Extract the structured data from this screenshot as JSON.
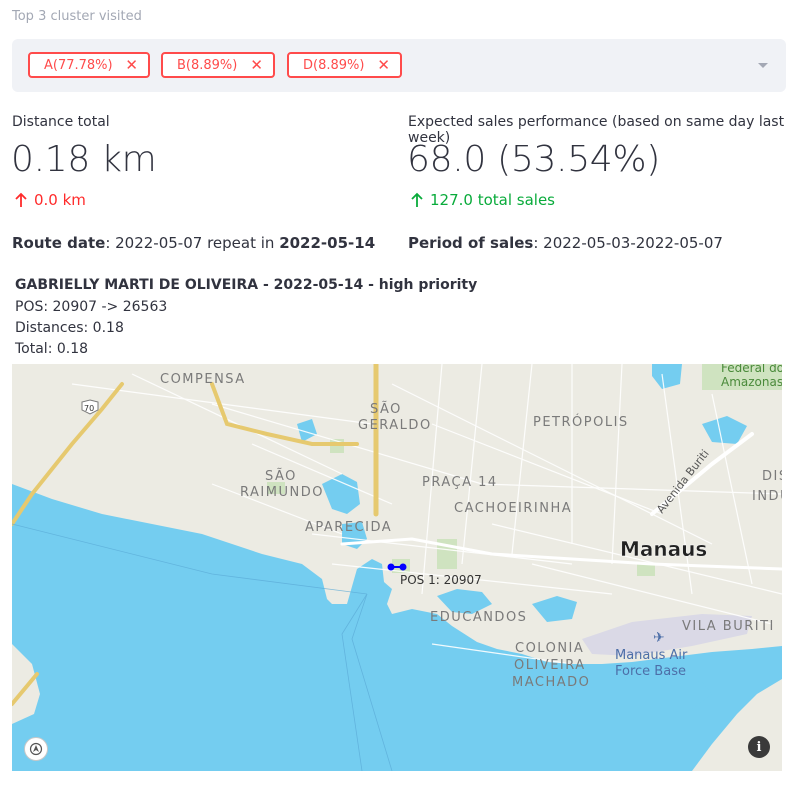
{
  "filter": {
    "label": "Top 3 cluster visited",
    "tags": [
      {
        "label": "A(77.78%)",
        "remove": "✕"
      },
      {
        "label": "B(8.89%)",
        "remove": "✕"
      },
      {
        "label": "D(8.89%)",
        "remove": "✕"
      }
    ]
  },
  "metrics": {
    "distance": {
      "label": "Distance total",
      "value": "0.18 km",
      "delta": "0.0 km"
    },
    "sales": {
      "label": "Expected sales performance (based on same day last week)",
      "value": "68.0 (53.54%)",
      "delta": "127.0 total sales"
    }
  },
  "info": {
    "route_label": "Route date",
    "route_value": ": 2022-05-07 repeat in ",
    "route_repeat": "2022-05-14",
    "period_label": "Period of sales",
    "period_value": ": 2022-05-03-2022-05-07"
  },
  "route": {
    "header": "GABRIELLY MARTI DE OLIVEIRA - 2022-05-14 - high priority",
    "pos": "POS: 20907 -> 26563",
    "distances": "Distances: 0.18",
    "total": "Total: 0.18"
  },
  "map": {
    "labels": {
      "compensa": "COMPENSA",
      "sao_geraldo_1": "SÃO",
      "sao_geraldo_2": "GERALDO",
      "petropolis": "PETRÓPOLIS",
      "sao_raimundo_1": "SÃO",
      "sao_raimundo_2": "RAIMUNDO",
      "praca14": "PRAÇA 14",
      "cachoeirinha": "CACHOEIRINHA",
      "aparecida": "APARECIDA",
      "manaus": "Manaus",
      "educandos": "EDUCANDOS",
      "colonia_1": "COLONIA",
      "colonia_2": "OLIVEIRA",
      "colonia_3": "MACHADO",
      "vila_buriti": "VILA BURITI",
      "air_base_1": "Manaus Air",
      "air_base_2": "Force Base",
      "avenida": "Avenida Buriti",
      "federal_1": "Federal do",
      "federal_2": "Amazonas",
      "dis": "DIS",
      "indu": "INDU",
      "road_70": "70",
      "pos_label": "POS 1: 20907"
    },
    "info_glyph": "i",
    "colors": {
      "water": "#74cdf0",
      "land": "#ecebe3",
      "park": "#cfe3c0",
      "marker": "#0000ff"
    }
  }
}
